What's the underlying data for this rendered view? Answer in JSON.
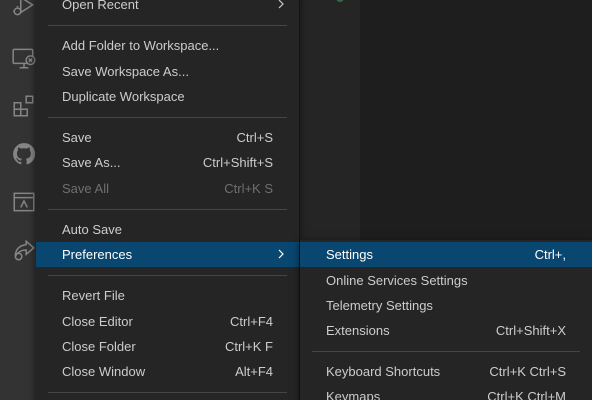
{
  "activity_bar": {
    "icons": [
      "run-debug-icon",
      "remote-explorer-icon",
      "extensions-icon",
      "github-icon",
      "terminal-panel-icon",
      "share-icon"
    ]
  },
  "file_menu": {
    "open_recent": "Open Recent",
    "add_folder": "Add Folder to Workspace...",
    "save_workspace_as": "Save Workspace As...",
    "duplicate_workspace": "Duplicate Workspace",
    "save": {
      "label": "Save",
      "shortcut": "Ctrl+S"
    },
    "save_as": {
      "label": "Save As...",
      "shortcut": "Ctrl+Shift+S"
    },
    "save_all": {
      "label": "Save All",
      "shortcut": "Ctrl+K S",
      "disabled": true
    },
    "auto_save": "Auto Save",
    "preferences": "Preferences",
    "revert_file": "Revert File",
    "close_editor": {
      "label": "Close Editor",
      "shortcut": "Ctrl+F4"
    },
    "close_folder": {
      "label": "Close Folder",
      "shortcut": "Ctrl+K F"
    },
    "close_window": {
      "label": "Close Window",
      "shortcut": "Alt+F4"
    }
  },
  "preferences_menu": {
    "settings": {
      "label": "Settings",
      "shortcut": "Ctrl+,"
    },
    "online_services": {
      "label": "Online Services Settings"
    },
    "telemetry": {
      "label": "Telemetry Settings"
    },
    "extensions": {
      "label": "Extensions",
      "shortcut": "Ctrl+Shift+X"
    },
    "keyboard_shortcuts": {
      "label": "Keyboard Shortcuts",
      "shortcut": "Ctrl+K Ctrl+S"
    },
    "keymaps": {
      "label": "Keymaps",
      "shortcut": "Ctrl+K Ctrl+M"
    }
  },
  "colors": {
    "menu_bg": "#252526",
    "active_item": "#094771",
    "separator": "#454545",
    "activity_bar": "#333333",
    "editor_bg": "#1e1e1e"
  }
}
